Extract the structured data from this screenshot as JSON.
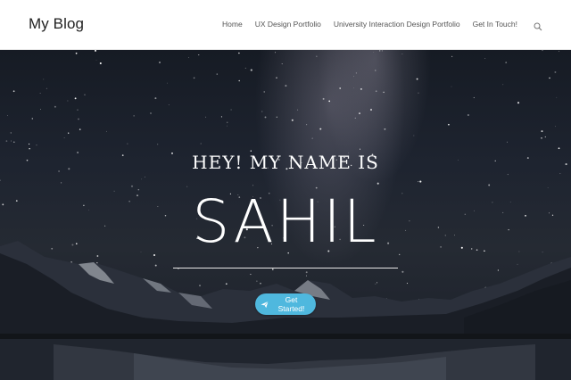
{
  "header": {
    "brand": "My Blog",
    "nav": [
      {
        "label": "Home"
      },
      {
        "label": "UX Design Portfolio"
      },
      {
        "label": "University Interaction Design Portfolio"
      },
      {
        "label": "Get In Touch!"
      }
    ],
    "search_icon": "search-icon"
  },
  "hero": {
    "subtitle": "HEY! MY NAME IS",
    "name": "SAHIL",
    "button": {
      "label": "Get Started!",
      "icon": "paper-plane-icon",
      "color": "#4fb8de"
    }
  }
}
